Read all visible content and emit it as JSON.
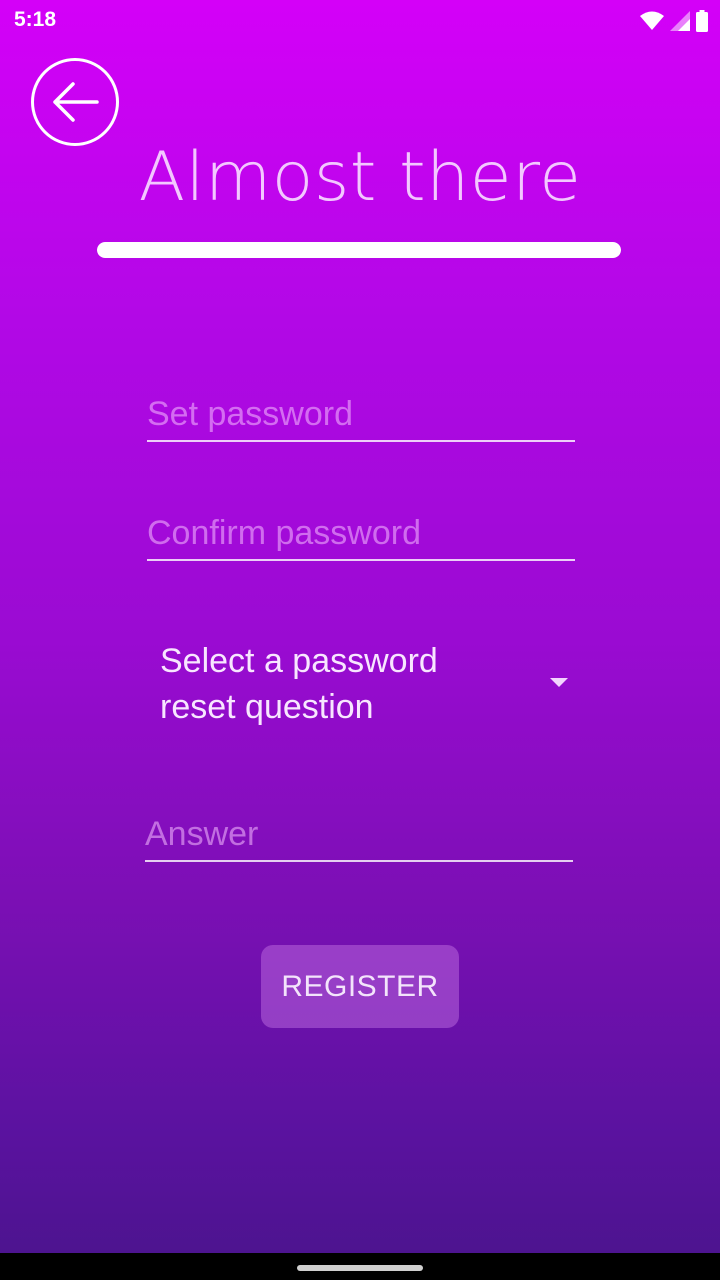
{
  "status_bar": {
    "time": "5:18",
    "icons": [
      "wifi-icon",
      "signal-icon",
      "battery-icon"
    ]
  },
  "header": {
    "back_icon": "arrow-left-icon",
    "title": "Almost there",
    "progress": 1.0
  },
  "form": {
    "set_password": {
      "placeholder": "Set password",
      "value": ""
    },
    "confirm_password": {
      "placeholder": "Confirm password",
      "value": ""
    },
    "reset_question": {
      "selected": "Select a password reset question"
    },
    "answer": {
      "placeholder": "Answer",
      "value": ""
    },
    "register_label": "REGISTER"
  },
  "colors": {
    "gradient_top": "#d400f8",
    "gradient_bottom": "#4a148c",
    "title_color": "#f3c8ff"
  }
}
